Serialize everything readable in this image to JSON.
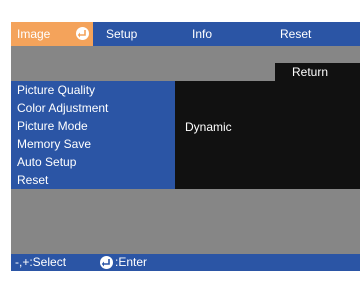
{
  "tabs": [
    {
      "label": "Image",
      "active": true
    },
    {
      "label": "Setup",
      "active": false
    },
    {
      "label": "Info",
      "active": false
    },
    {
      "label": "Reset",
      "active": false
    }
  ],
  "return_label": "Return",
  "menu": {
    "items": [
      "Picture Quality",
      "Color Adjustment",
      "Picture Mode",
      "Memory Save",
      "Auto Setup",
      "Reset"
    ],
    "picture_mode_value": "Dynamic"
  },
  "footer": {
    "select_hint": "-,+:Select",
    "enter_hint": ":Enter"
  },
  "colors": {
    "tab_active": "#f4a35b",
    "bar": "#2b55a5",
    "panel_dark": "#111111",
    "background": "#868686"
  }
}
